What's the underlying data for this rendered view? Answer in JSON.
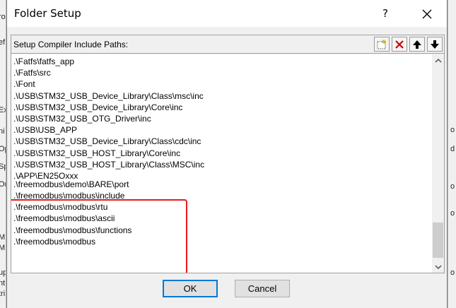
{
  "dialog": {
    "title": "Folder Setup",
    "help_label": "?"
  },
  "group": {
    "label": "Setup Compiler Include Paths:"
  },
  "paths": [
    ".\\Fatfs\\fatfs_app",
    ".\\Fatfs\\src",
    ".\\Font",
    ".\\USB\\STM32_USB_Device_Library\\Class\\msc\\inc",
    ".\\USB\\STM32_USB_Device_Library\\Core\\inc",
    ".\\USB\\STM32_USB_OTG_Driver\\inc",
    ".\\USB\\USB_APP",
    ".\\USB\\STM32_USB_Device_Library\\Class\\cdc\\inc",
    ".\\USB\\STM32_USB_HOST_Library\\Core\\inc",
    ".\\USB\\STM32_USB_HOST_Library\\Class\\MSC\\inc",
    ".\\APP\\EN25Qxxx",
    ".\\freemodbus\\demo\\BARE\\port",
    ".\\freemodbus\\modbus\\include",
    ".\\freemodbus\\modbus\\rtu",
    ".\\freemodbus\\modbus\\ascii",
    ".\\freemodbus\\modbus\\functions",
    ".\\freemodbus\\modbus"
  ],
  "buttons": {
    "ok": "OK",
    "cancel": "Cancel"
  },
  "colors": {
    "highlight": "#e8191a",
    "delete_icon": "#cc0000"
  },
  "icons": [
    "new-folder-icon",
    "delete-icon",
    "move-up-icon",
    "move-down-icon",
    "close-icon"
  ]
}
